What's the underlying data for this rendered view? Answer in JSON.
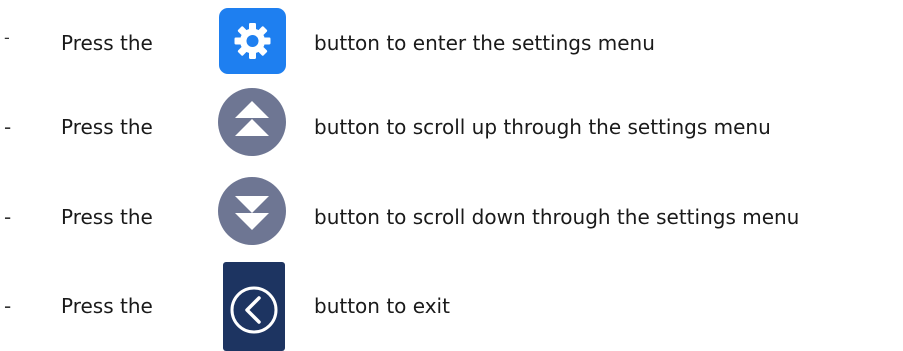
{
  "instructions": [
    {
      "bullet": "-",
      "prefix": "Press the",
      "icon": "gear-icon",
      "icon_color": "#1e7ff0",
      "text": "button to enter the settings menu"
    },
    {
      "bullet": "-",
      "prefix": "Press the",
      "icon": "double-chevron-up-icon",
      "icon_color": "#6e7693",
      "text": "button to scroll up through the settings menu"
    },
    {
      "bullet": "-",
      "prefix": "Press the",
      "icon": "double-chevron-down-icon",
      "icon_color": "#6e7693",
      "text": "button to scroll down through the settings menu"
    },
    {
      "bullet": "-",
      "prefix": "Press the",
      "icon": "back-chevron-icon",
      "icon_color": "#1d3461",
      "text": "button to exit"
    }
  ]
}
